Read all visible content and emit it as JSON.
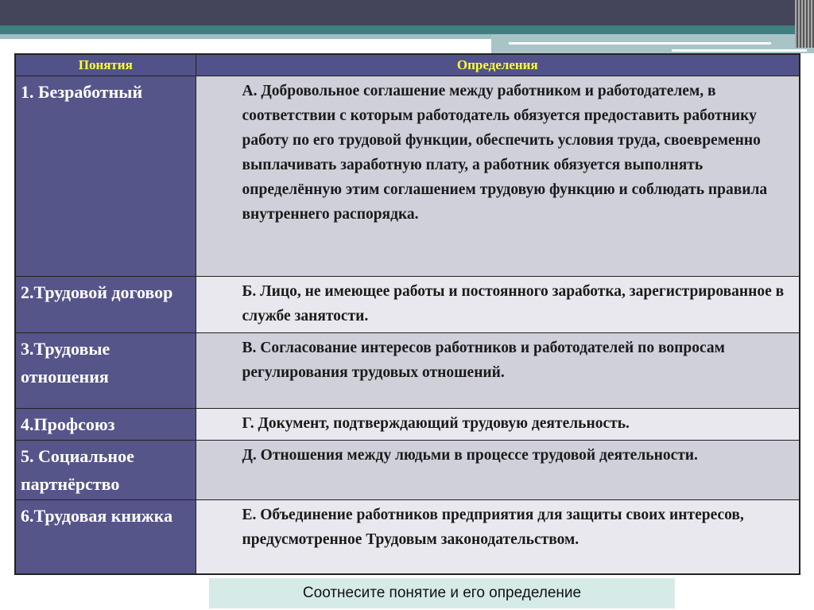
{
  "header": {
    "col1": "Понятия",
    "col2": "Определения"
  },
  "rows": [
    {
      "term": "1. Безработный",
      "definition": "А. Добровольное соглашение между работником и работодателем, в соответствии с которым работодатель обязуется предоставить работнику работу по его трудовой функции, обеспечить условия труда, своевременно выплачивать заработную плату, а работник обязуется выполнять определённую этим соглашением трудовую функцию и соблюдать правила внутреннего распорядка."
    },
    {
      "term": "2.Трудовой договор",
      "definition": "Б. Лицо, не имеющее работы и  постоянного заработка, зарегистрированное в службе занятости."
    },
    {
      "term": "3.Трудовые отношения",
      "definition": "В. Согласование интересов работников и работодателей по вопросам регулирования трудовых отношений."
    },
    {
      "term": "4.Профсоюз",
      "definition": "Г. Документ, подтверждающий трудовую деятельность."
    },
    {
      "term": "5. Социальное партнёрство",
      "definition": "Д. Отношения между людьми в процессе трудовой деятельности."
    },
    {
      "term": "6.Трудовая книжка",
      "definition": "Е. Объединение работников предприятия для защиты своих интересов, предусмотренное Трудовым законодательством."
    }
  ],
  "instruction": "Соотнесите понятие и его определение"
}
